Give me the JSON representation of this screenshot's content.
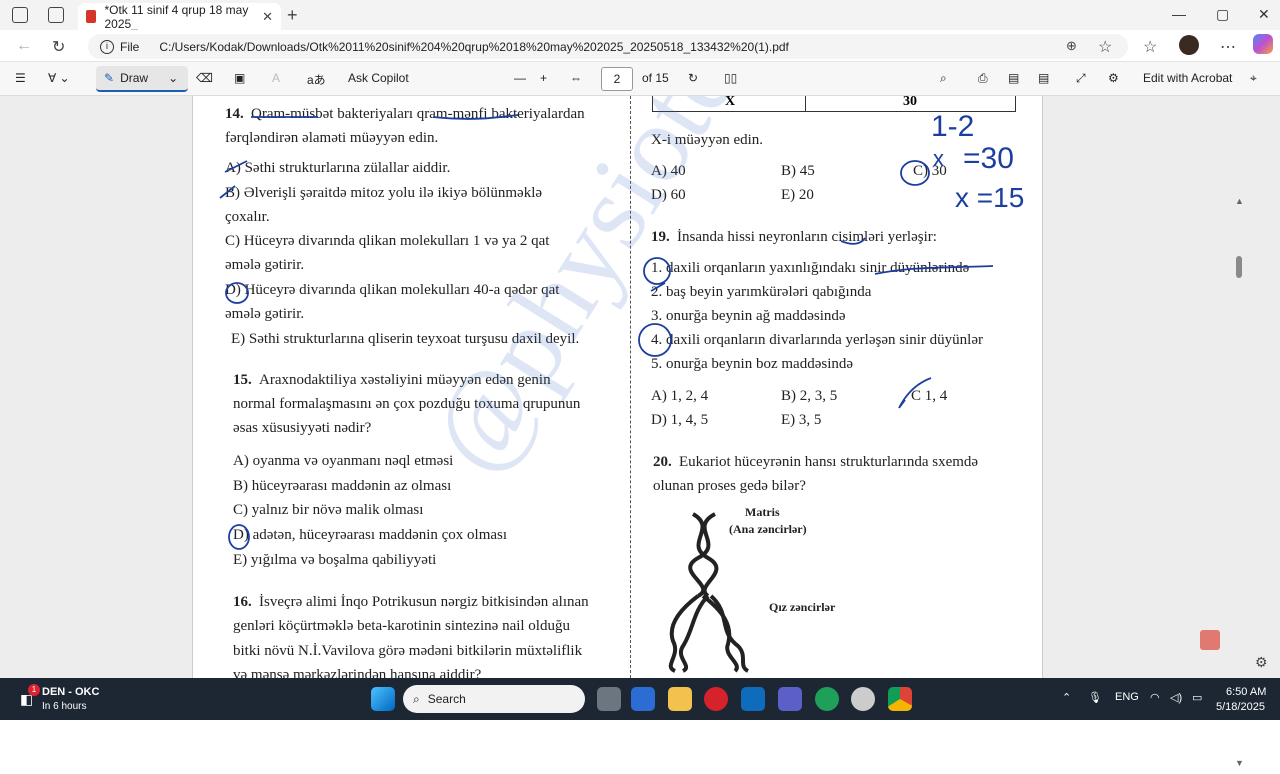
{
  "browser": {
    "tab_title": "*Otk 11 sinif 4 qrup 18 may 2025_",
    "tab_close": "✕",
    "new_tab": "+",
    "file_label": "File",
    "url": "C:/Users/Kodak/Downloads/Otk%2011%20sinif%204%20qrup%2018%20may%202025_20250518_133432%20(1).pdf"
  },
  "pdf_toolbar": {
    "draw_label": "Draw",
    "ask_copilot": "Ask Copilot",
    "current_page": "2",
    "page_total": "of 15",
    "edit_with_acrobat": "Edit with Acrobat"
  },
  "table_row": {
    "left": "X",
    "right": "30"
  },
  "left_col": {
    "q14_num": "14.",
    "q14_l1": "Qram-müsbət bakteriyaları qram-mənfi bakteriyalardan",
    "q14_l2": "fərqləndirən əlaməti müəyyən edin.",
    "q14_a": "A) Səthi strukturlarına zülallar aiddir.",
    "q14_b1": "B) Əlverişli şəraitdə mitoz yolu ilə ikiyə bölünməklə",
    "q14_b2": "çoxalır.",
    "q14_c1": "C) Hüceyrə divarında qlikan molekulları 1 və ya 2 qat",
    "q14_c2": "əmələ gətirir.",
    "q14_d1": "D) Hüceyrə divarında qlikan molekulları 40-a qədər qat",
    "q14_d2": "əmələ gətirir.",
    "q14_e": "E) Səthi strukturlarına qliserin teyxoat turşusu daxil deyil.",
    "q15_num": "15.",
    "q15_l1": "Araxnodaktiliya xəstəliyini müəyyən edən genin",
    "q15_l2": "normal formalaşmasını ən çox pozduğu toxuma qrupunun",
    "q15_l3": "əsas xüsusiyyəti nədir?",
    "q15_a": "A) oyanma və oyanmanı nəql etməsi",
    "q15_b": "B) hüceyrəarası maddənin az olması",
    "q15_c": "C) yalnız bir növə malik olması",
    "q15_d": "D) adətən, hüceyrəarası maddənin çox olması",
    "q15_e": "E) yığılma və boşalma qabiliyyəti",
    "q16_num": "16.",
    "q16_l1": "İsveçrə alimi İnqo Potrikusun nərgiz bitkisindən alınan",
    "q16_l2": "genləri köçürtməklə beta-karotinin sintezinə nail olduğu",
    "q16_l3": "bitki növü N.İ.Vavilova görə mədəni bitkilərin müxtəliflik",
    "q16_l4": "və mənşə mərkəzlərindən hansına aiddir?"
  },
  "right_col": {
    "x_question": "X-i müəyyən edin.",
    "x_a": "A) 40",
    "x_b": "B) 45",
    "x_c": "C) 30",
    "x_d": "D) 60",
    "x_e": "E) 20",
    "q19_num": "19.",
    "q19_l1": "İnsanda hissi neyronların cisimləri yerləşir:",
    "q19_1": "1. daxili orqanların yaxınlığındakı sinir düyünlərində",
    "q19_2": "2. baş beyin yarımkürələri qabığında",
    "q19_3": "3. onurğa beynin ağ maddəsində",
    "q19_4": "4. daxili orqanların divarlarında yerləşən sinir düyünlər",
    "q19_5": "5. onurğa beynin boz maddəsində",
    "q19_a": "A) 1, 2, 4",
    "q19_b": "B) 2, 3, 5",
    "q19_c": "C  1, 4",
    "q19_d": "D) 1, 4, 5",
    "q19_e": "E) 3, 5",
    "q20_num": "20.",
    "q20_l1": "Eukariot hüceyrənin hansı strukturlarında sxemdə",
    "q20_l2": "olunan proses gedə bilər?",
    "fig_matris": "Matris",
    "fig_ana": "(Ana zəncirlər)",
    "fig_qiz": "Qız zəncirlər"
  },
  "handwriting": {
    "h1": "1-2",
    "h2": "x",
    "h3": "=30",
    "h4": "x =15"
  },
  "watermark": "@physiotest",
  "taskbar": {
    "weather_title": "DEN - OKC",
    "weather_sub": "In 6 hours",
    "badge": "1",
    "search": "Search",
    "lang": "ENG",
    "time": "6:50 AM",
    "date": "5/18/2025"
  }
}
